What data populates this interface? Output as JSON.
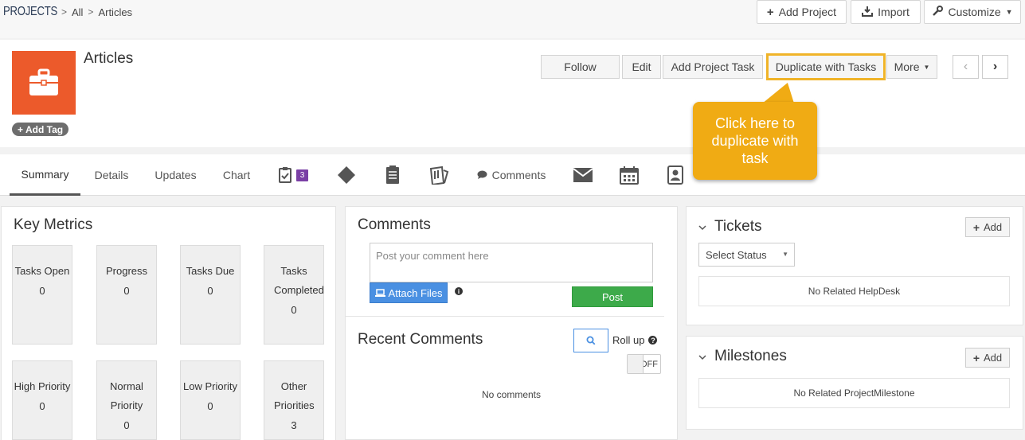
{
  "breadcrumb": {
    "root": "PROJECTS",
    "level1": "All",
    "level2": "Articles"
  },
  "top_actions": {
    "add_project": "Add Project",
    "import": "Import",
    "customize": "Customize"
  },
  "project": {
    "title": "Articles",
    "add_tag": "Add Tag"
  },
  "header_actions": {
    "follow": "Follow",
    "edit": "Edit",
    "add_project_task": "Add Project Task",
    "duplicate_with_tasks": "Duplicate with Tasks",
    "more": "More"
  },
  "callout": {
    "text": "Click here to duplicate with task"
  },
  "tabs": {
    "summary": "Summary",
    "details": "Details",
    "updates": "Updates",
    "chart": "Chart",
    "tasks_badge": "3",
    "comments": "Comments"
  },
  "key_metrics": {
    "title": "Key Metrics",
    "items": [
      {
        "label": "Tasks Open",
        "value": "0"
      },
      {
        "label": "Progress",
        "value": "0"
      },
      {
        "label": "Tasks Due",
        "value": "0"
      },
      {
        "label": "Tasks Completed",
        "value": "0"
      },
      {
        "label": "High Priority",
        "value": "0"
      },
      {
        "label": "Normal Priority",
        "value": "0"
      },
      {
        "label": "Low Priority",
        "value": "0"
      },
      {
        "label": "Other Priorities",
        "value": "3"
      }
    ]
  },
  "comments": {
    "title": "Comments",
    "placeholder": "Post your comment here",
    "attach_files": "Attach Files",
    "post": "Post",
    "recent_title": "Recent Comments",
    "roll_up": "Roll up",
    "toggle_state": "OFF",
    "empty": "No comments"
  },
  "tickets": {
    "title": "Tickets",
    "add": "Add",
    "select_status": "Select Status",
    "empty": "No Related HelpDesk"
  },
  "milestones": {
    "title": "Milestones",
    "add": "Add",
    "empty": "No Related ProjectMilestone"
  },
  "colors": {
    "logo": "#ec5a2b",
    "callout": "#f0ab14",
    "badge": "#7a3fa5",
    "attach": "#4a90e2",
    "post": "#3daa4a"
  }
}
